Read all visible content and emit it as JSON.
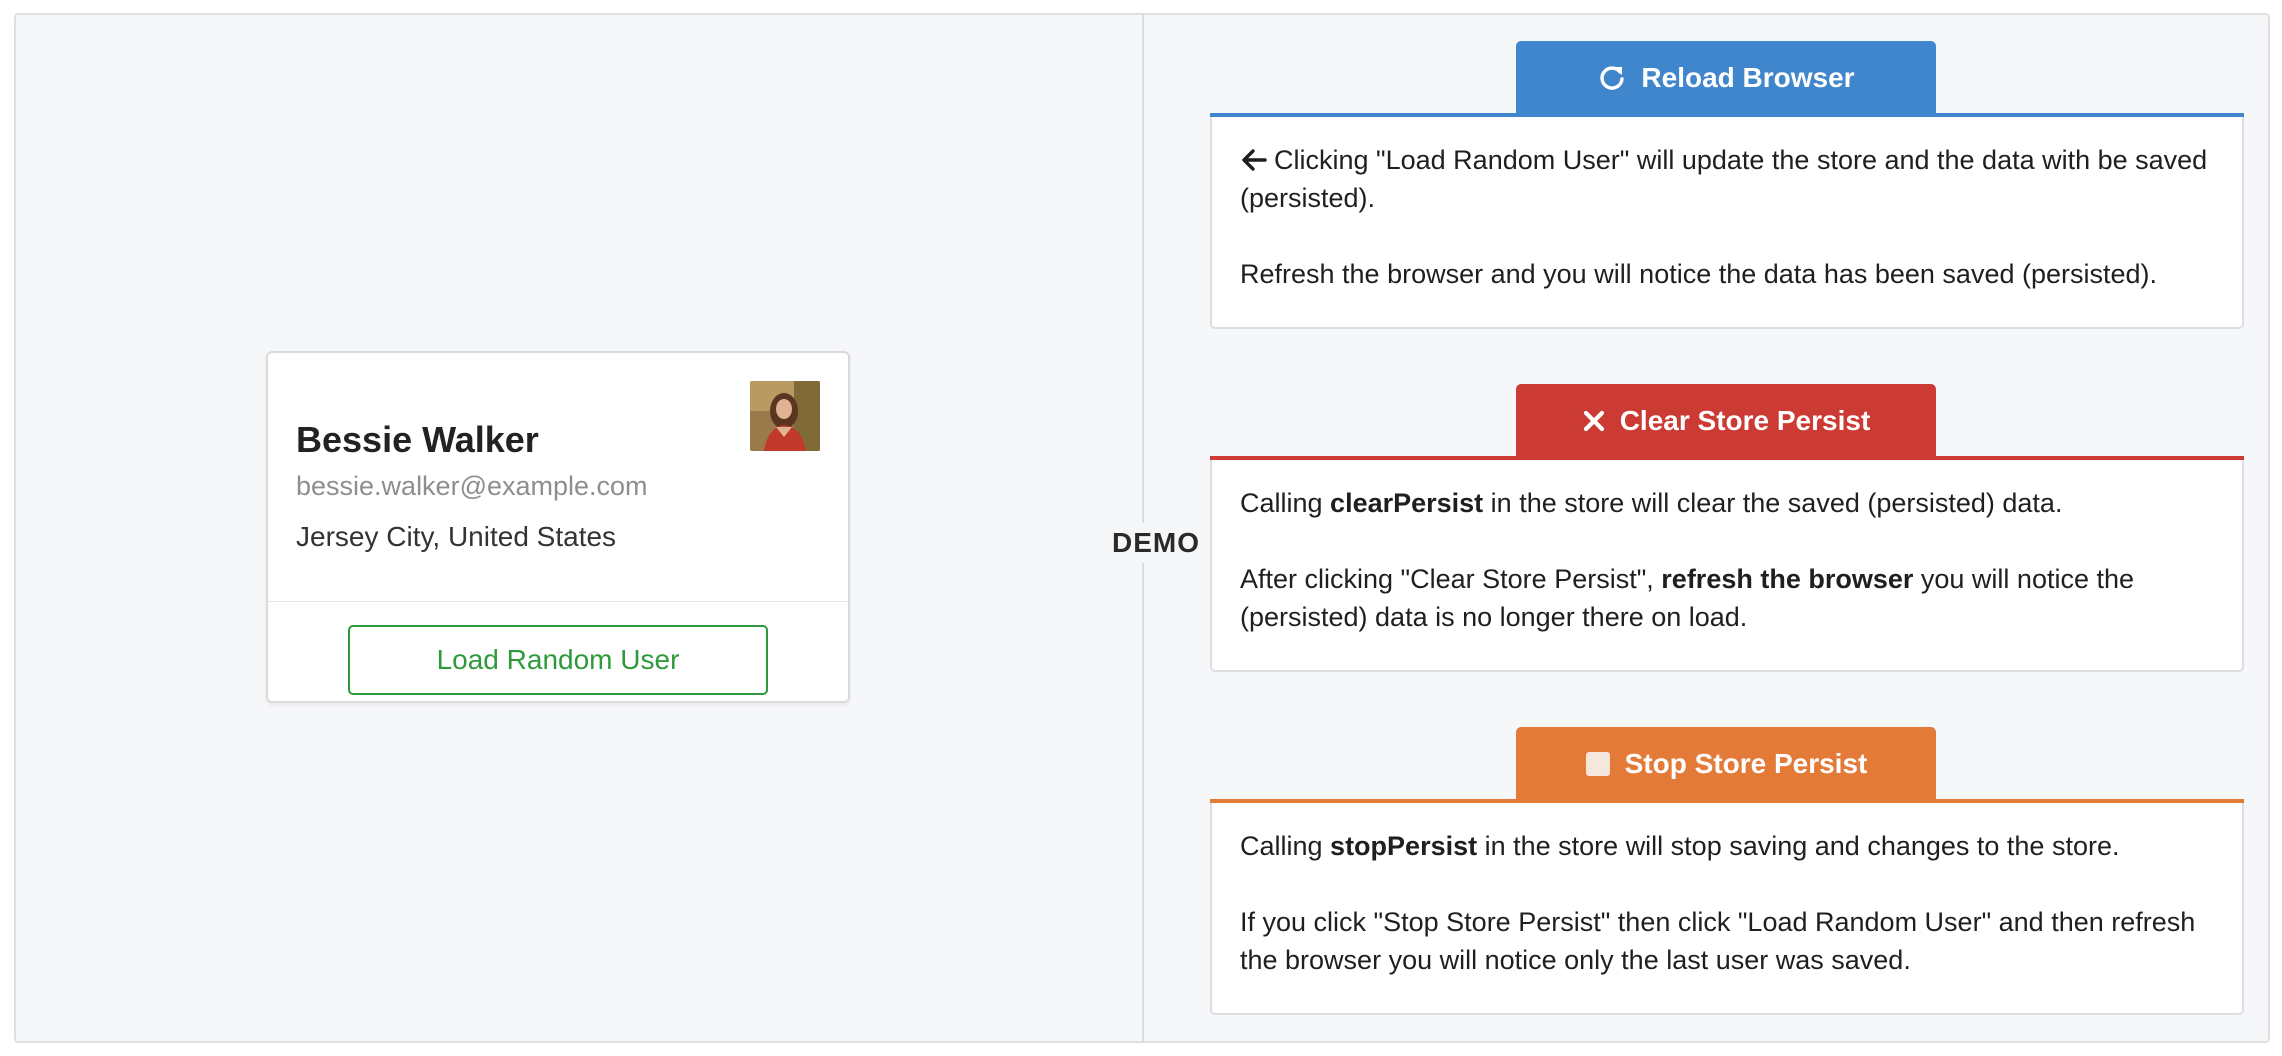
{
  "demo_label": "DEMO",
  "user_card": {
    "name": "Bessie Walker",
    "email": "bessie.walker@example.com",
    "location": "Jersey City, United States",
    "load_button_label": "Load Random User",
    "avatar_icon": "user-photo"
  },
  "panels": {
    "reload": {
      "label": "Reload Browser",
      "icon": "reload-icon",
      "color": "#3f86cc",
      "line1_prefix": "Clicking \"Load Random User\" will update the store and the data with be saved (persisted).",
      "line2": "Refresh the browser and you will notice the data has been saved (persisted)."
    },
    "clear": {
      "label": "Clear Store Persist",
      "icon": "close-icon",
      "color": "#cc3a34",
      "p1_before": "Calling ",
      "p1_bold": "clearPersist",
      "p1_after": " in the store will clear the saved (persisted) data.",
      "p2_before": "After clicking \"Clear Store Persist\", ",
      "p2_bold": "refresh the browser",
      "p2_after": " you will notice the (persisted) data is no longer there on load."
    },
    "stop": {
      "label": "Stop Store Persist",
      "icon": "stop-square-icon",
      "color": "#e47a38",
      "p1_before": "Calling ",
      "p1_bold": "stopPersist",
      "p1_after": " in the store will stop saving and changes to the store.",
      "p2": "If you click \"Stop Store Persist\" then click \"Load Random User\" and then refresh the browser you will notice only the last user was saved."
    }
  }
}
